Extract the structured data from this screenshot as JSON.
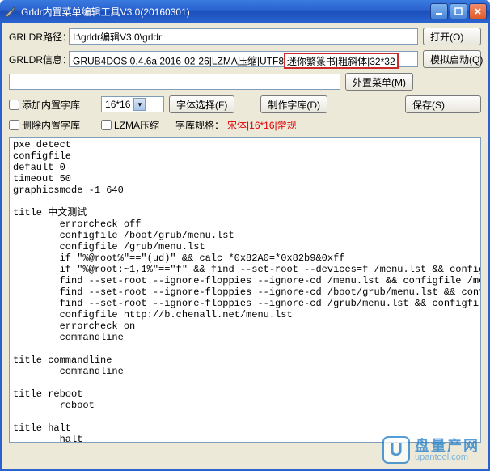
{
  "window": {
    "title": "Grldr内置菜单编辑工具V3.0(20160301)"
  },
  "labels": {
    "path": "GRLDR路径：",
    "info": "GRLDR信息："
  },
  "fields": {
    "path_value": "I:\\grldr编辑V3.0\\grldr",
    "info_prefix": "GRUB4DOS 0.4.6a 2016-02-26|LZMA压缩|UTF8",
    "info_highlight": "迷你繁篆书|粗斜体|32*32",
    "menu_value": ""
  },
  "buttons": {
    "open": "打开(O)",
    "simulate": "模拟启动(Q)",
    "external_menu": "外置菜单(M)",
    "font_select": "字体选择(F)",
    "make_font": "制作字库(D)",
    "save": "保存(S)"
  },
  "checkboxes": {
    "add_font": "添加内置字库",
    "del_font": "删除内置字库",
    "lzma": "LZMA压缩"
  },
  "combo": {
    "fontsize": "16*16"
  },
  "spec": {
    "label": "字库规格：",
    "value": "宋体|16*16|常规"
  },
  "editor": "pxe detect\nconfigfile\ndefault 0\ntimeout 50\ngraphicsmode -1 640\n\ntitle 中文测试\n        errorcheck off\n        configfile /boot/grub/menu.lst\n        configfile /grub/menu.lst\n        if \"%@root%\"==\"(ud)\" && calc *0x82A0=*0x82b9&0xff\n        if \"%@root:~1,1%\"==\"f\" && find --set-root --devices=f /menu.lst && configfile /menu.l\n        find --set-root --ignore-floppies --ignore-cd /menu.lst && configfile /menu.lst\n        find --set-root --ignore-floppies --ignore-cd /boot/grub/menu.lst && configfile /boot\n        find --set-root --ignore-floppies --ignore-cd /grub/menu.lst && configfile /grub/menu\n        configfile http://b.chenall.net/menu.lst\n        errorcheck on\n        commandline\n\ntitle commandline\n        commandline\n\ntitle reboot\n        reboot\n\ntitle halt\n        halt\n",
  "watermark": {
    "line1": "盘量产网",
    "line2": "upantool.com"
  }
}
